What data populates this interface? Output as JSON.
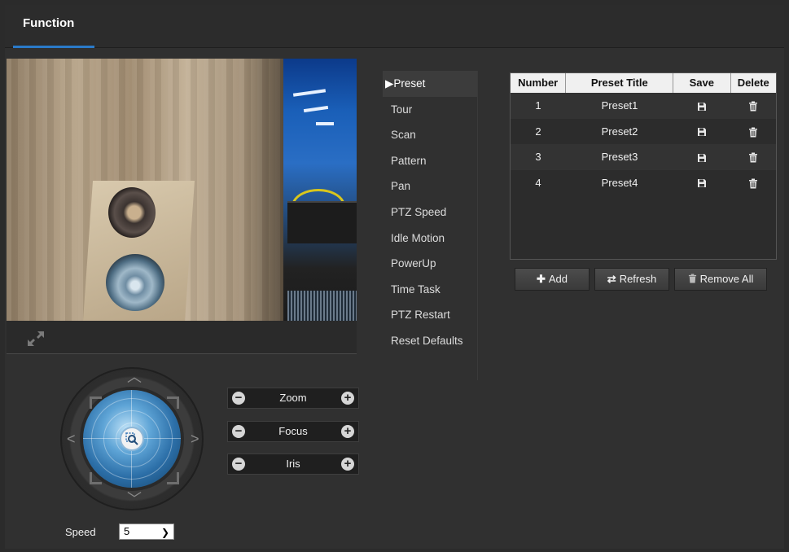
{
  "header": {
    "tab_label": "Function"
  },
  "controls": {
    "zoom_label": "Zoom",
    "focus_label": "Focus",
    "iris_label": "Iris",
    "minus_symbol": "−",
    "plus_symbol": "+"
  },
  "speed": {
    "label": "Speed",
    "value": "5"
  },
  "menu": {
    "items": [
      {
        "label": "▶Preset"
      },
      {
        "label": "Tour"
      },
      {
        "label": "Scan"
      },
      {
        "label": "Pattern"
      },
      {
        "label": "Pan"
      },
      {
        "label": "PTZ Speed"
      },
      {
        "label": "Idle Motion"
      },
      {
        "label": "PowerUp"
      },
      {
        "label": "Time Task"
      },
      {
        "label": "PTZ Restart"
      },
      {
        "label": "Reset Defaults"
      }
    ]
  },
  "preset_table": {
    "headers": [
      "Number",
      "Preset Title",
      "Save",
      "Delete"
    ],
    "rows": [
      {
        "number": "1",
        "title": "Preset1"
      },
      {
        "number": "2",
        "title": "Preset2"
      },
      {
        "number": "3",
        "title": "Preset3"
      },
      {
        "number": "4",
        "title": "Preset4"
      }
    ]
  },
  "actions": {
    "add_label": "Add",
    "refresh_label": "Refresh",
    "remove_all_label": "Remove All"
  },
  "icons": {
    "fullscreen": "expand-arrows-icon",
    "save": "floppy-disk-icon",
    "delete": "trash-icon",
    "ptz_center": "zoom-search-icon"
  },
  "colors": {
    "accent": "#2a7ac9",
    "background": "#2c2c2c",
    "table_header": "#f0f0f0"
  }
}
